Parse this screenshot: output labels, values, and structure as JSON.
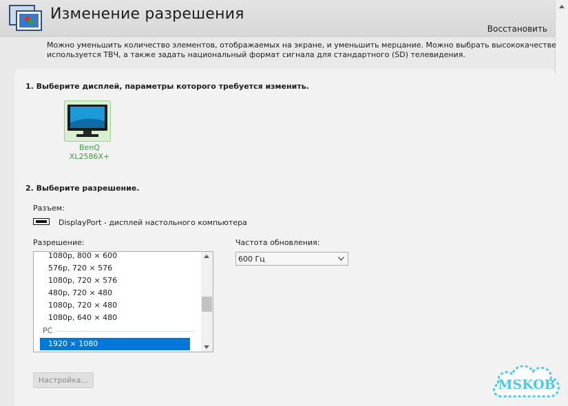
{
  "header": {
    "title": "Изменение разрешения",
    "restore_link": "Восстановить"
  },
  "description": {
    "line1": "Можно уменьшить количество элементов, отображаемых на экране, и уменьшить мерцание. Можно выбрать высококачественный (HD) формат",
    "line2": "используется ТВЧ, а также задать национальный формат сигнала для стандартного (SD) телевидения."
  },
  "step1": {
    "title": "1. Выберите дисплей, параметры которого требуется изменить.",
    "display_name": "BenQ XL2586X+"
  },
  "step2": {
    "title": "2. Выберите разрешение.",
    "connector_label": "Разъем:",
    "connector_value": "DisplayPort - дисплей настольного компьютера",
    "resolution_label": "Разрешение:",
    "refresh_label": "Частота обновления:",
    "refresh_value": "600 Гц",
    "resolutions": [
      "1080p, 800 × 600",
      "576p, 720 × 576",
      "1080p, 720 × 576",
      "480p, 720 × 480",
      "1080p, 720 × 480",
      "1080p, 640 × 480"
    ],
    "group_label": "PC",
    "selected_resolution": "1920 × 1080",
    "settings_button": "Настройка..."
  },
  "watermark": {
    "text": "MSKOB"
  },
  "colors": {
    "selection": "#0078d7",
    "display_name": "#3c9b3c",
    "watermark": "#4cc9e6"
  }
}
